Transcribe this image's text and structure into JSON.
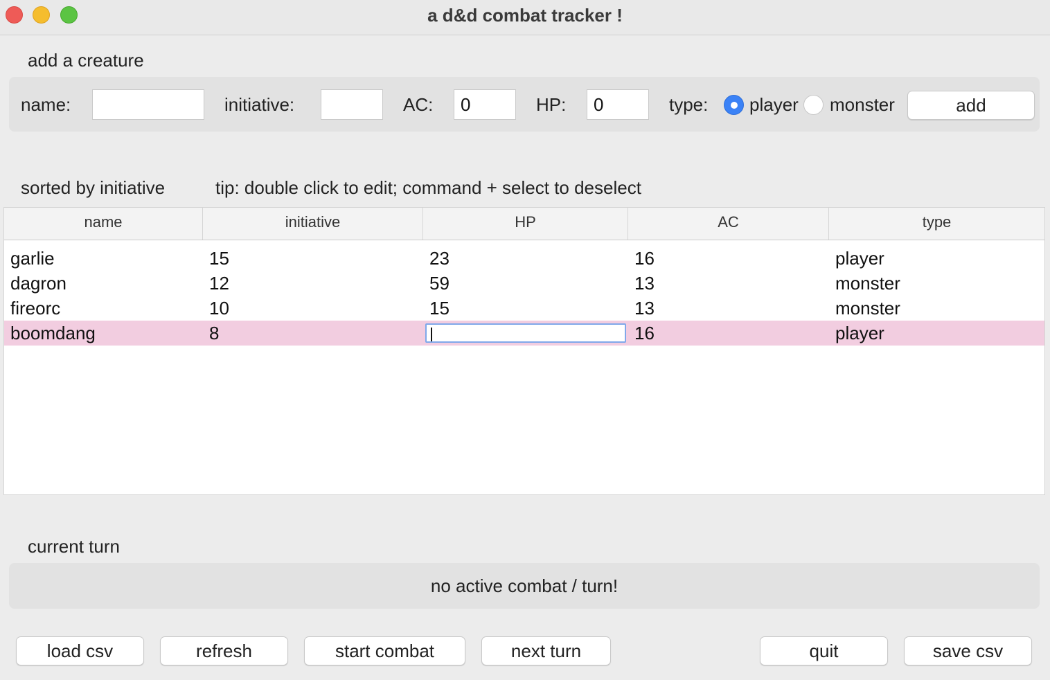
{
  "window": {
    "title": "a d&d combat tracker !"
  },
  "add_section": {
    "heading": "add a creature",
    "name_label": "name:",
    "name_value": "",
    "initiative_label": "initiative:",
    "initiative_value": "",
    "ac_label": "AC:",
    "ac_value": "0",
    "hp_label": "HP:",
    "hp_value": "0",
    "type_label": "type:",
    "type_options": [
      "player",
      "monster"
    ],
    "type_selected": "player",
    "add_button": "add"
  },
  "list_section": {
    "heading": "sorted by initiative",
    "tip": "tip: double click to edit; command + select to deselect",
    "columns": [
      "name",
      "initiative",
      "HP",
      "AC",
      "type"
    ],
    "rows": [
      {
        "name": "garlie",
        "initiative": "15",
        "hp": "23",
        "ac": "16",
        "type": "player"
      },
      {
        "name": "dagron",
        "initiative": "12",
        "hp": "59",
        "ac": "13",
        "type": "monster"
      },
      {
        "name": "fireorc",
        "initiative": "10",
        "hp": "15",
        "ac": "13",
        "type": "monster"
      },
      {
        "name": "boomdang",
        "initiative": "8",
        "hp": "",
        "ac": "16",
        "type": "player"
      }
    ],
    "selected_row": "boomdang",
    "editing_cell": "HP"
  },
  "turn_section": {
    "heading": "current turn",
    "status": "no active combat / turn!"
  },
  "buttons": {
    "load_csv": "load csv",
    "refresh": "refresh",
    "start_combat": "start combat",
    "next_turn": "next turn",
    "quit": "quit",
    "save_csv": "save csv"
  },
  "colors": {
    "selected_row": "#f2cde0",
    "radio_accent": "#3b82f6"
  }
}
